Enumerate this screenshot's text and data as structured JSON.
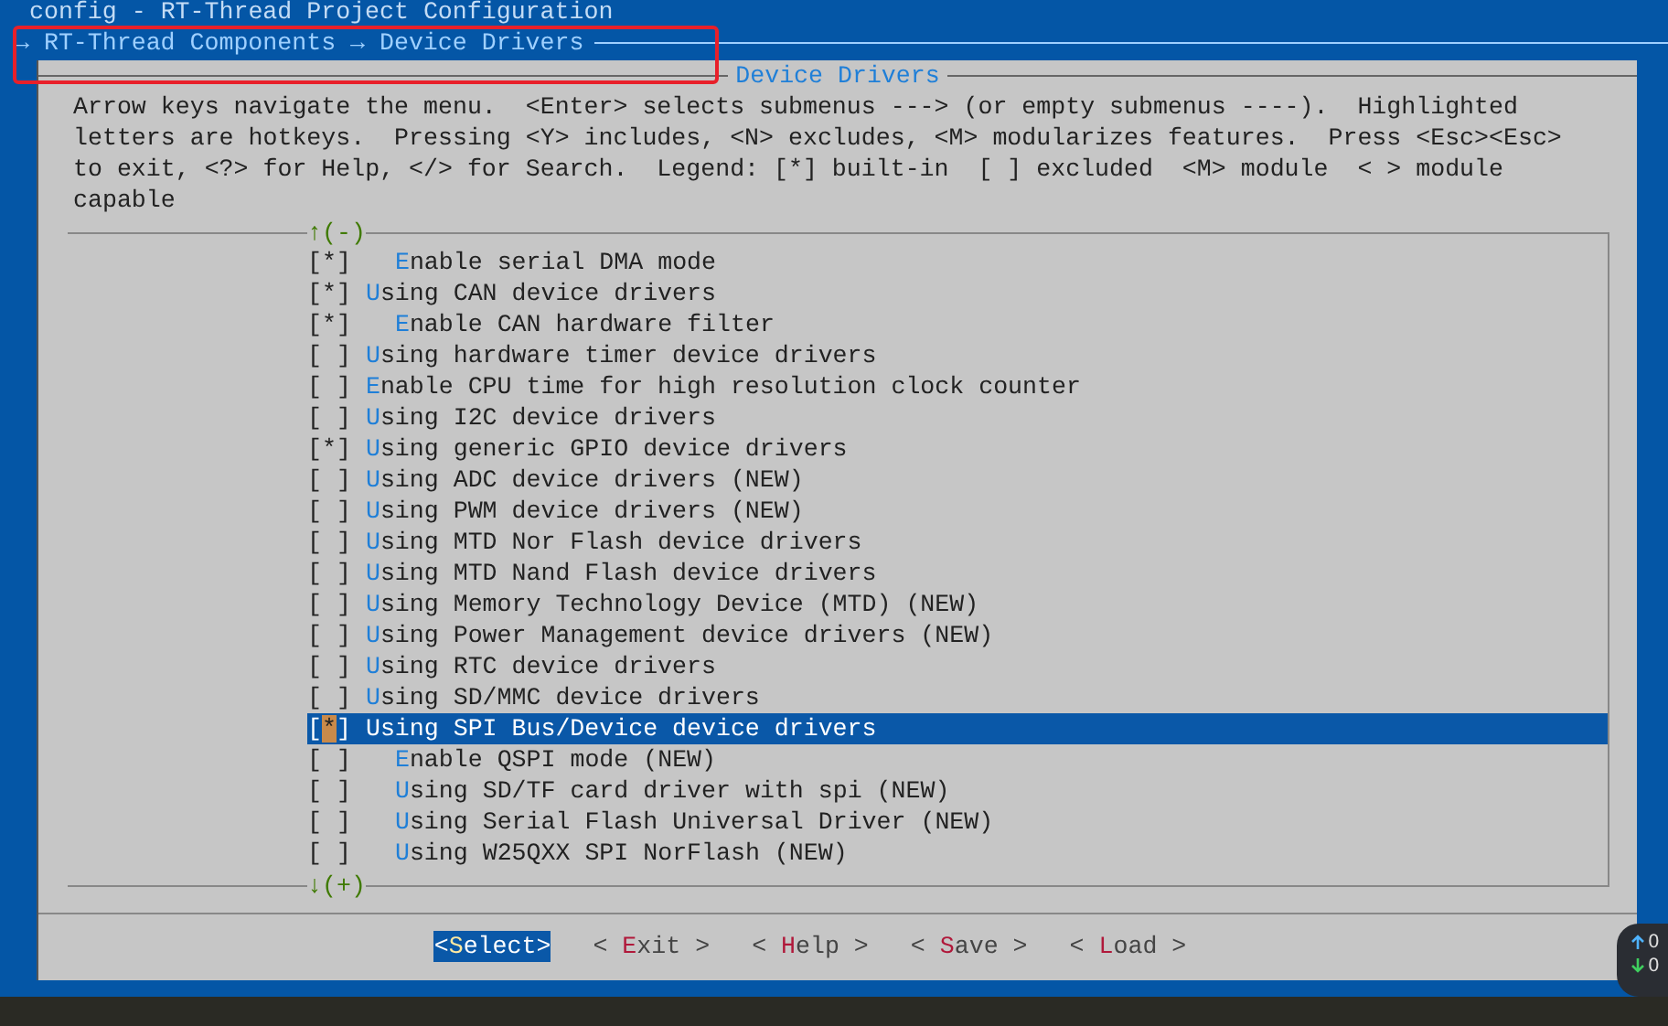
{
  "window": {
    "title": "config - RT-Thread Project Configuration"
  },
  "breadcrumb": "→ RT-Thread Components → Device Drivers",
  "dialog": {
    "title": "Device Drivers",
    "help_lines": [
      "Arrow keys navigate the menu.  <Enter> selects submenus ---> (or empty submenus ----).  Highlighted",
      "letters are hotkeys.  Pressing <Y> includes, <N> excludes, <M> modularizes features.  Press <Esc><Esc>",
      "to exit, <?> for Help, </> for Search.  Legend: [*] built-in  [ ] excluded  <M> module  < > module",
      "capable"
    ],
    "scroll_up": "↑(-)",
    "scroll_down": "↓(+)",
    "items": [
      {
        "children": [
          {
            "box": "[*]",
            "label": "**E**nable serial DMA mode",
            "selected": false
          }
        ]
      },
      {
        "box": "[*]",
        "label": "**U**sing CAN device drivers",
        "selected": false,
        "children": [
          {
            "box": "[*]",
            "label": "**E**nable CAN hardware filter",
            "selected": false
          }
        ]
      },
      {
        "box": "[ ]",
        "label": "**U**sing hardware timer device drivers",
        "selected": false
      },
      {
        "box": "[ ]",
        "label": "**E**nable CPU time for high resolution clock counter",
        "selected": false
      },
      {
        "box": "[ ]",
        "label": "**U**sing I2C device drivers",
        "selected": false
      },
      {
        "box": "[*]",
        "label": "**U**sing generic GPIO device drivers",
        "selected": false
      },
      {
        "box": "[ ]",
        "label": "**U**sing ADC device drivers (NEW)",
        "selected": false
      },
      {
        "box": "[ ]",
        "label": "**U**sing PWM device drivers (NEW)",
        "selected": false
      },
      {
        "box": "[ ]",
        "label": "**U**sing MTD Nor Flash device drivers",
        "selected": false
      },
      {
        "box": "[ ]",
        "label": "**U**sing MTD Nand Flash device drivers",
        "selected": false
      },
      {
        "box": "[ ]",
        "label": "**U**sing Memory Technology Device (MTD) (NEW)",
        "selected": false
      },
      {
        "box": "[ ]",
        "label": "**U**sing Power Management device drivers (NEW)",
        "selected": false
      },
      {
        "box": "[ ]",
        "label": "**U**sing RTC device drivers",
        "selected": false
      },
      {
        "box": "[ ]",
        "label": "**U**sing SD/MMC device drivers",
        "selected": false
      },
      {
        "box": "[*]",
        "label": "**U**sing SPI Bus/Device device drivers",
        "selected": true,
        "children": [
          {
            "box": "[ ]",
            "label": "**E**nable QSPI mode (NEW)",
            "selected": false
          },
          {
            "box": "[ ]",
            "label": "**U**sing SD/TF card driver with spi (NEW)",
            "selected": false
          },
          {
            "box": "[ ]",
            "label": "**U**sing Serial Flash Universal Driver (NEW)",
            "selected": false
          },
          {
            "box": "[ ]",
            "label": "**U**sing W25QXX SPI NorFlash (NEW)",
            "selected": false
          }
        ]
      }
    ],
    "buttons": [
      {
        "label": "<**S**elect>",
        "selected": true
      },
      {
        "label": "< **E**xit >",
        "selected": false
      },
      {
        "label": "< **H**elp >",
        "selected": false
      },
      {
        "label": "< **S**ave >",
        "selected": false
      },
      {
        "label": "< **L**oad >",
        "selected": false
      }
    ]
  },
  "net_widget": {
    "up": "0",
    "down": "0"
  }
}
